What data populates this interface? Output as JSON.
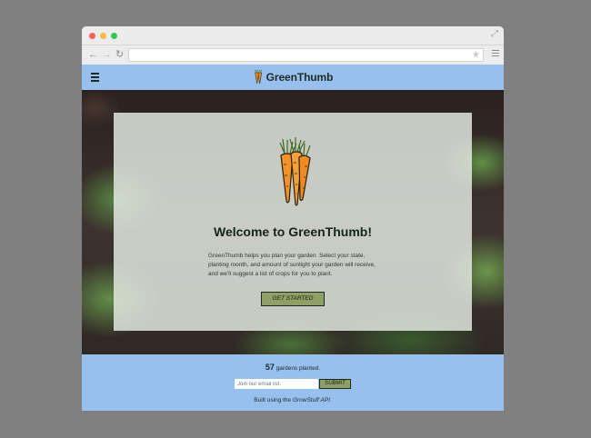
{
  "site": {
    "brand_name": "GreenThumb"
  },
  "hero": {
    "welcome_title": "Welcome to GreenThumb!",
    "intro_text": "GreenThumb helps you plan your garden. Select your state, planting month, and amount of sunlight your garden will receive, and we'll suggest a list of crops for you to plant.",
    "cta_label": "GET STARTED"
  },
  "footer": {
    "gardens_count": "57",
    "gardens_suffix": " gardens planted.",
    "email_placeholder": "Join our email list.",
    "submit_label": "SUBMIT",
    "credit_prefix": "Built using the ",
    "credit_api": "GrowStuff API",
    "credit_suffix": "."
  },
  "colors": {
    "header_bg": "#97c0ee",
    "button_bg": "#8ea065",
    "text_dark": "#14241b",
    "carrot": "#f0932b"
  },
  "icons": [
    "hamburger-menu-icon",
    "carrot-logo-icon",
    "back-arrow-icon",
    "forward-arrow-icon",
    "reload-icon",
    "star-icon",
    "browser-menu-icon",
    "expand-icon"
  ]
}
